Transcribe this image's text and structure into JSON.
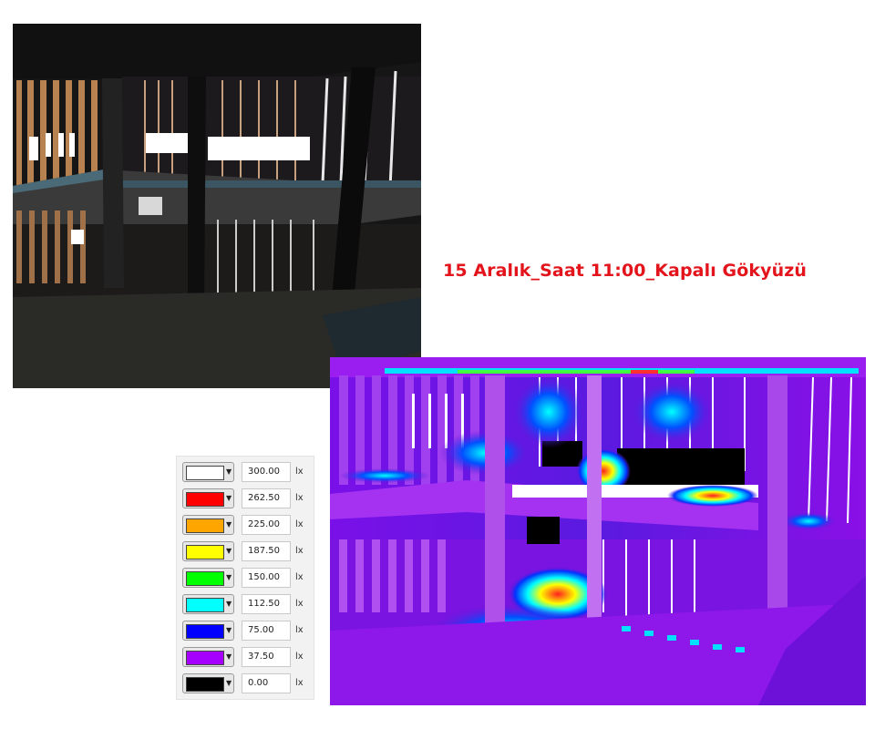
{
  "title": "15 Aralık_Saat 11:00_Kapalı Gökyüzü",
  "legend": [
    {
      "color": "#ffffff",
      "value": "300.00",
      "unit": "lx"
    },
    {
      "color": "#ff0000",
      "value": "262.50",
      "unit": "lx"
    },
    {
      "color": "#ffa500",
      "value": "225.00",
      "unit": "lx"
    },
    {
      "color": "#ffff00",
      "value": "187.50",
      "unit": "lx"
    },
    {
      "color": "#00ff00",
      "value": "150.00",
      "unit": "lx"
    },
    {
      "color": "#00ffff",
      "value": "112.50",
      "unit": "lx"
    },
    {
      "color": "#0000ff",
      "value": "75.00",
      "unit": "lx"
    },
    {
      "color": "#a500ff",
      "value": "37.50",
      "unit": "lx"
    },
    {
      "color": "#000000",
      "value": "0.00",
      "unit": "lx"
    }
  ]
}
